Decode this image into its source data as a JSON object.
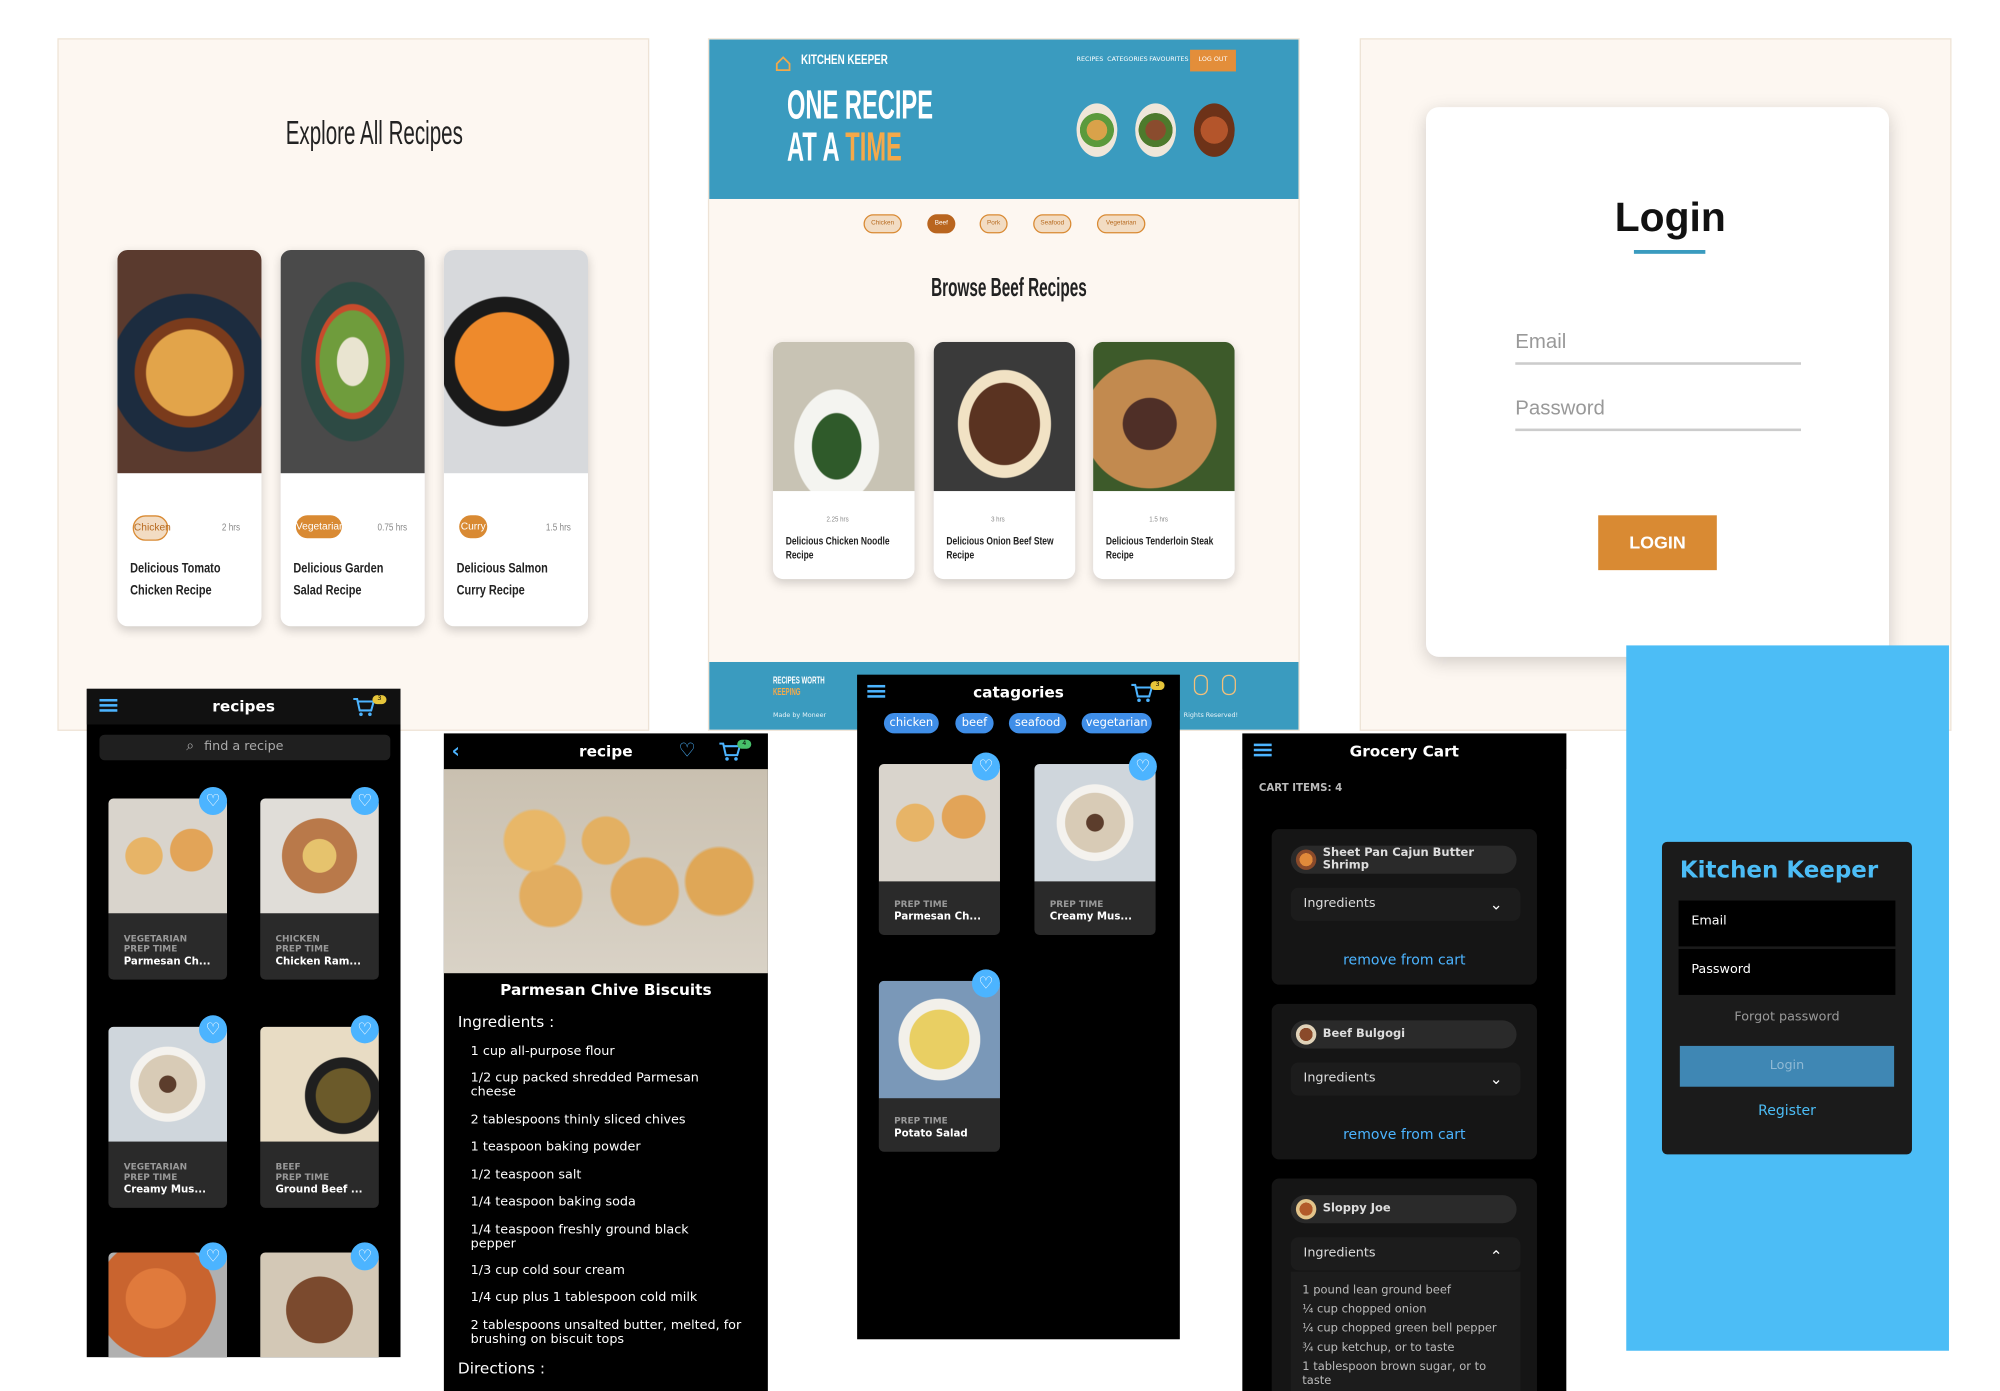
{
  "explore": {
    "title": "Explore All Recipes",
    "cards": [
      {
        "tag": "Chicken",
        "time": "2 hrs",
        "name": "Delicious Tomato Chicken Recipe"
      },
      {
        "tag": "Vegetarian",
        "time": "0.75 hrs",
        "name": "Delicious Garden Salad Recipe"
      },
      {
        "tag": "Curry",
        "time": "1.5 hrs",
        "name": "Delicious Salmon Curry Recipe"
      }
    ]
  },
  "landing": {
    "brand": "KITCHEN KEEPER",
    "nav": [
      "RECIPES",
      "CATEGORIES",
      "FAVOURITES"
    ],
    "logout": "LOG OUT",
    "hero_line1": "ONE RECIPE",
    "hero_line2a": "AT A",
    "hero_line2b": "TIME",
    "chips": [
      "Chicken",
      "Beef",
      "Pork",
      "Seafood",
      "Vegetarian"
    ],
    "browse_title": "Browse Beef Recipes",
    "cards": [
      {
        "time": "2.25 hrs",
        "name": "Delicious Chicken Noodle Recipe"
      },
      {
        "time": "3 hrs",
        "name": "Delicious Onion Beef Stew Recipe"
      },
      {
        "time": "1.5 hrs",
        "name": "Delicious Tenderloin Steak Recipe"
      }
    ],
    "footer_brand1": "RECIPES WORTH",
    "footer_brand2": "KEEPING",
    "footer_made": "Made by Moneer",
    "footer_rights": "Rights Reserved!"
  },
  "login_desktop": {
    "title": "Login",
    "email_placeholder": "Email",
    "password_placeholder": "Password",
    "button": "LOGIN"
  },
  "recipes_mobile": {
    "title": "recipes",
    "cart_count": "3",
    "search_placeholder": "find a recipe",
    "cards": [
      {
        "cat": "VEGETARIAN",
        "prep": "PREP TIME",
        "name": "Parmesan Ch..."
      },
      {
        "cat": "CHICKEN",
        "prep": "PREP TIME",
        "name": "Chicken Ram..."
      },
      {
        "cat": "VEGETARIAN",
        "prep": "PREP TIME",
        "name": "Creamy Mus..."
      },
      {
        "cat": "BEEF",
        "prep": "PREP TIME",
        "name": "Ground Beef ..."
      }
    ]
  },
  "recipe_mobile": {
    "title": "recipe",
    "cart_count": "4",
    "dish": "Parmesan Chive Biscuits",
    "ingredients_label": "Ingredients :",
    "ingredients": [
      "1 cup all-purpose flour",
      "1/2 cup packed shredded Parmesan cheese",
      "2 tablespoons thinly sliced chives",
      "1 teaspoon baking powder",
      "1/2 teaspoon salt",
      "1/4 teaspoon baking soda",
      "1/4 teaspoon freshly ground black pepper",
      "1/3 cup cold sour cream",
      "1/4 cup plus 1 tablespoon cold milk",
      "2 tablespoons unsalted butter, melted, for brushing on biscuit tops"
    ],
    "directions_label": "Directions :"
  },
  "categories_mobile": {
    "title": "catagories",
    "cart_count": "3",
    "chips": [
      "chicken",
      "beef",
      "seafood",
      "vegetarian"
    ],
    "cards": [
      {
        "prep": "PREP TIME",
        "name": "Parmesan Ch..."
      },
      {
        "prep": "PREP TIME",
        "name": "Creamy Mus..."
      },
      {
        "prep": "PREP TIME",
        "name": "Potato Salad"
      }
    ]
  },
  "cart_mobile": {
    "title": "Grocery Cart",
    "count_label": "CART ITEMS: 4",
    "items": [
      {
        "name": "Sheet Pan Cajun Butter Shrimp",
        "ingredients_label": "Ingredients",
        "remove": "remove from cart"
      },
      {
        "name": "Beef Bulgogi",
        "ingredients_label": "Ingredients",
        "remove": "remove from cart"
      },
      {
        "name": "Sloppy Joe",
        "ingredients_label": "Ingredients"
      }
    ],
    "sloppy_ingredients": [
      "1 pound lean ground beef",
      "¼ cup chopped onion",
      "¼ cup chopped green bell pepper",
      "¾ cup ketchup, or to taste",
      "1 tablespoon brown sugar, or to taste"
    ]
  },
  "login_mobile": {
    "title": "Kitchen Keeper",
    "email_placeholder": "Email",
    "password_placeholder": "Password",
    "forgot": "Forgot password",
    "button": "Login",
    "register": "Register"
  },
  "colors": {
    "accent_orange": "#d98a33",
    "hero_blue": "#3a9bbf",
    "mobile_blue": "#4cbdf6"
  }
}
